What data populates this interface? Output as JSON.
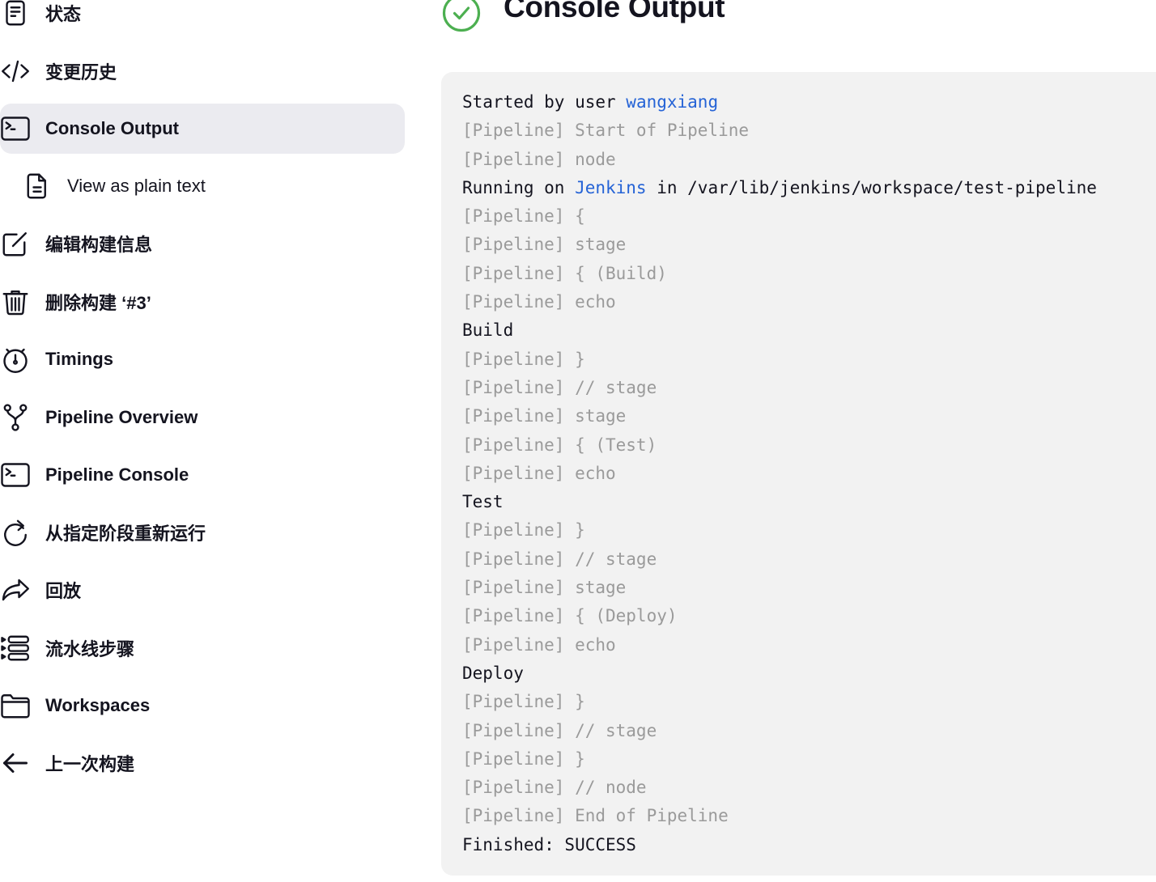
{
  "sidebar": {
    "items": [
      {
        "label": "状态",
        "icon": "document-icon"
      },
      {
        "label": "变更历史",
        "icon": "code-icon"
      },
      {
        "label": "Console Output",
        "icon": "terminal-icon",
        "active": true
      },
      {
        "label": "View as plain text",
        "icon": "file-text-icon",
        "sub": true
      },
      {
        "label": "编辑构建信息",
        "icon": "edit-icon"
      },
      {
        "label": "删除构建 ‘#3’",
        "icon": "trash-icon"
      },
      {
        "label": "Timings",
        "icon": "stopwatch-icon"
      },
      {
        "label": "Pipeline Overview",
        "icon": "git-branch-icon"
      },
      {
        "label": "Pipeline Console",
        "icon": "terminal-icon"
      },
      {
        "label": "从指定阶段重新运行",
        "icon": "restart-icon"
      },
      {
        "label": "回放",
        "icon": "replay-arrow-icon"
      },
      {
        "label": "流水线步骤",
        "icon": "steps-list-icon"
      },
      {
        "label": "Workspaces",
        "icon": "folder-icon"
      },
      {
        "label": "上一次构建",
        "icon": "arrow-left-icon"
      }
    ]
  },
  "header": {
    "title": "Console Output",
    "status": "success",
    "status_color": "#4caf50"
  },
  "console": {
    "link_color": "#2563d6",
    "lines": [
      {
        "parts": [
          {
            "text": "Started by user "
          },
          {
            "text": "wangxiang",
            "link": true
          }
        ]
      },
      {
        "parts": [
          {
            "text": "[Pipeline] Start of Pipeline",
            "muted": true
          }
        ]
      },
      {
        "parts": [
          {
            "text": "[Pipeline] node",
            "muted": true
          }
        ]
      },
      {
        "parts": [
          {
            "text": "Running on "
          },
          {
            "text": "Jenkins",
            "link": true
          },
          {
            "text": " in /var/lib/jenkins/workspace/test-pipeline"
          }
        ]
      },
      {
        "parts": [
          {
            "text": "[Pipeline] {",
            "muted": true
          }
        ]
      },
      {
        "parts": [
          {
            "text": "[Pipeline] stage",
            "muted": true
          }
        ]
      },
      {
        "parts": [
          {
            "text": "[Pipeline] { (Build)",
            "muted": true
          }
        ]
      },
      {
        "parts": [
          {
            "text": "[Pipeline] echo",
            "muted": true
          }
        ]
      },
      {
        "parts": [
          {
            "text": "Build"
          }
        ]
      },
      {
        "parts": [
          {
            "text": "[Pipeline] }",
            "muted": true
          }
        ]
      },
      {
        "parts": [
          {
            "text": "[Pipeline] // stage",
            "muted": true
          }
        ]
      },
      {
        "parts": [
          {
            "text": "[Pipeline] stage",
            "muted": true
          }
        ]
      },
      {
        "parts": [
          {
            "text": "[Pipeline] { (Test)",
            "muted": true
          }
        ]
      },
      {
        "parts": [
          {
            "text": "[Pipeline] echo",
            "muted": true
          }
        ]
      },
      {
        "parts": [
          {
            "text": "Test"
          }
        ]
      },
      {
        "parts": [
          {
            "text": "[Pipeline] }",
            "muted": true
          }
        ]
      },
      {
        "parts": [
          {
            "text": "[Pipeline] // stage",
            "muted": true
          }
        ]
      },
      {
        "parts": [
          {
            "text": "[Pipeline] stage",
            "muted": true
          }
        ]
      },
      {
        "parts": [
          {
            "text": "[Pipeline] { (Deploy)",
            "muted": true
          }
        ]
      },
      {
        "parts": [
          {
            "text": "[Pipeline] echo",
            "muted": true
          }
        ]
      },
      {
        "parts": [
          {
            "text": "Deploy"
          }
        ]
      },
      {
        "parts": [
          {
            "text": "[Pipeline] }",
            "muted": true
          }
        ]
      },
      {
        "parts": [
          {
            "text": "[Pipeline] // stage",
            "muted": true
          }
        ]
      },
      {
        "parts": [
          {
            "text": "[Pipeline] }",
            "muted": true
          }
        ]
      },
      {
        "parts": [
          {
            "text": "[Pipeline] // node",
            "muted": true
          }
        ]
      },
      {
        "parts": [
          {
            "text": "[Pipeline] End of Pipeline",
            "muted": true
          }
        ]
      },
      {
        "parts": [
          {
            "text": "Finished: SUCCESS"
          }
        ]
      }
    ]
  }
}
